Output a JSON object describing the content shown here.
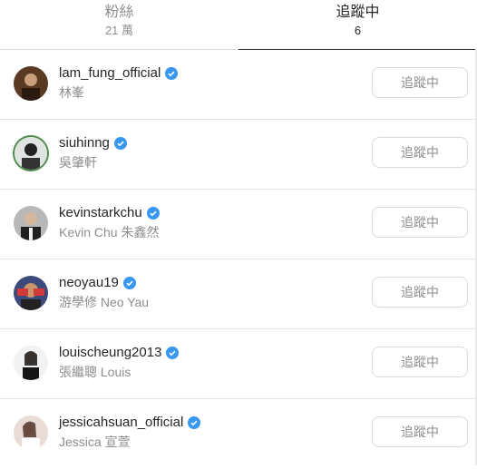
{
  "tabs": [
    {
      "label": "粉絲",
      "count": "21 萬"
    },
    {
      "label": "追蹤中",
      "count": "6"
    }
  ],
  "colors": {
    "verified": "#3897f0",
    "text": "#262626",
    "muted": "#8e8e8e",
    "border": "#dbdbdb"
  },
  "following": [
    {
      "username": "lam_fung_official",
      "full_name": "林峯",
      "button": "追蹤中",
      "verified": true
    },
    {
      "username": "siuhinng",
      "full_name": "吳肇軒",
      "button": "追蹤中",
      "verified": true
    },
    {
      "username": "kevinstarkchu",
      "full_name": "Kevin Chu 朱鑫然",
      "button": "追蹤中",
      "verified": true
    },
    {
      "username": "neoyau19",
      "full_name": "游學修 Neo Yau",
      "button": "追蹤中",
      "verified": true
    },
    {
      "username": "louischeung2013",
      "full_name": "張繼聰 Louis",
      "button": "追蹤中",
      "verified": true
    },
    {
      "username": "jessicahsuan_official",
      "full_name": "Jessica 宣萱",
      "button": "追蹤中",
      "verified": true
    }
  ]
}
